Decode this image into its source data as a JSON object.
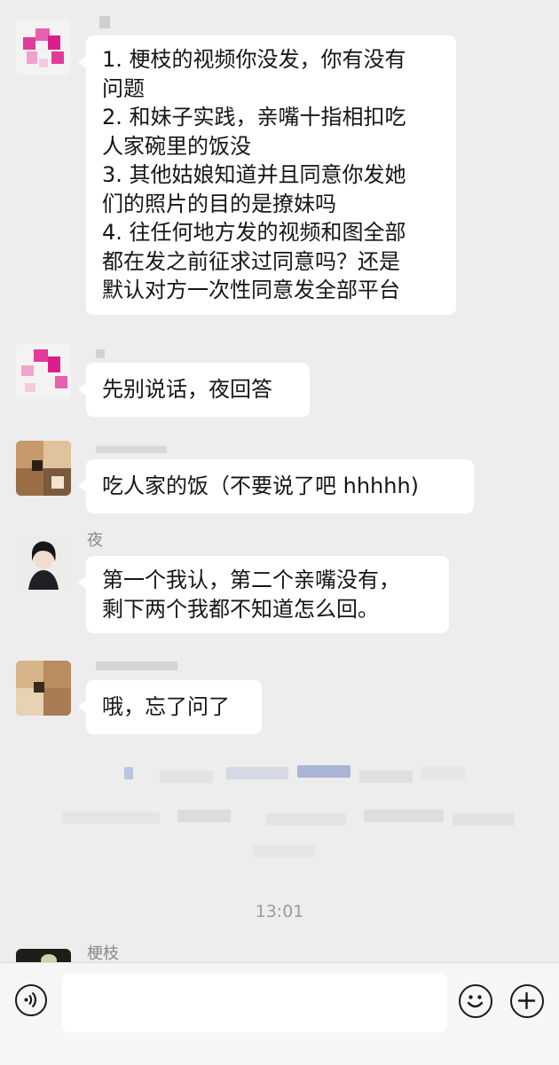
{
  "messages": [
    {
      "sender": "",
      "lines": [
        "1. 梗枝的视频你没发，你有没有",
        "问题",
        "2. 和妹子实践，亲嘴十指相扣吃",
        "人家碗里的饭没",
        "3. 其他姑娘知道并且同意你发她",
        "们的照片的目的是撩妹吗",
        "4. 往任何地方发的视频和图全部",
        "都在发之前征求过同意吗？还是",
        "默认对方一次性同意发全部平台"
      ]
    },
    {
      "sender": "",
      "lines": [
        "先别说话，夜回答"
      ]
    },
    {
      "sender": "",
      "lines": [
        "吃人家的饭（不要说了吧 hhhhh)"
      ]
    },
    {
      "sender": "夜",
      "lines": [
        "第一个我认，第二个亲嘴没有，",
        "剩下两个我都不知道怎么回。"
      ]
    },
    {
      "sender": "",
      "lines": [
        "哦，忘了问了"
      ]
    }
  ],
  "time_label": "13:01",
  "last_sender": "梗枝",
  "input": {
    "value": "",
    "placeholder": ""
  },
  "icons": {
    "voice": "voice-icon",
    "emoji": "emoji-icon",
    "plus": "plus-icon"
  },
  "colors": {
    "background": "#ededed",
    "bubble": "#ffffff",
    "accent_pink": "#e4389a"
  }
}
